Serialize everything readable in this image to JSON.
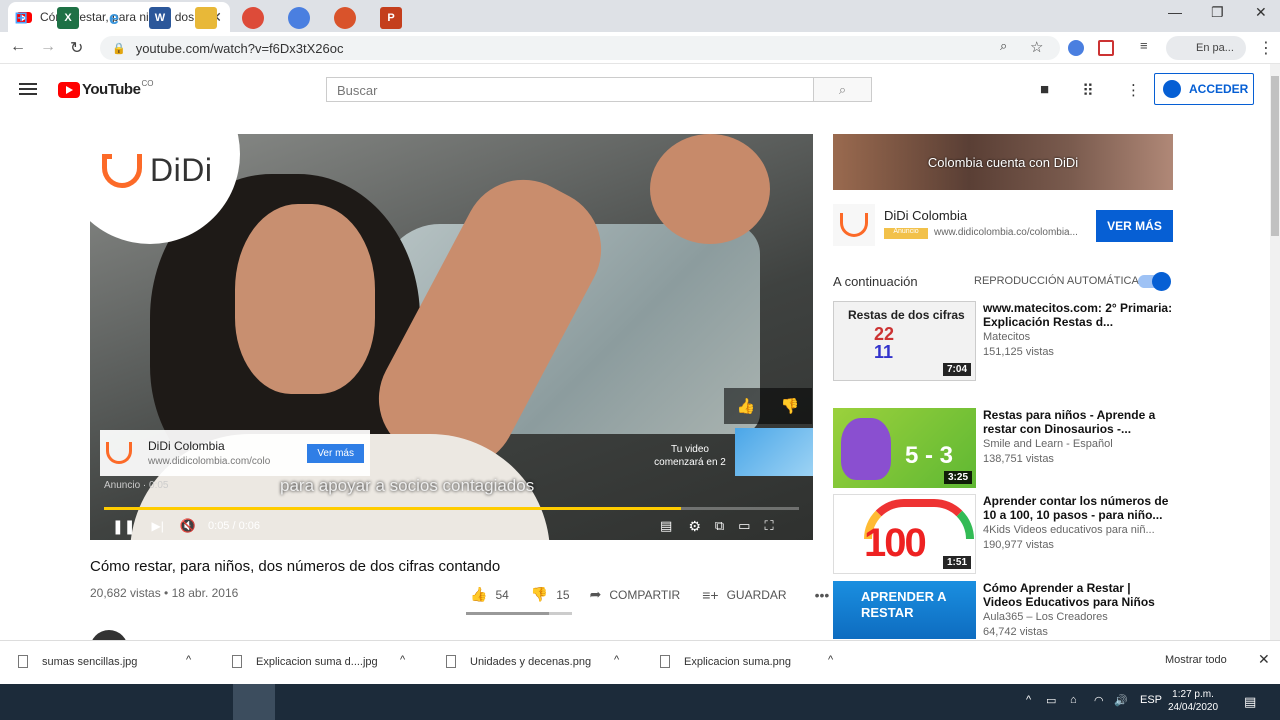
{
  "browser": {
    "tab_title": "Cómo restar, para niños, dos nú",
    "tab_close": "✕",
    "new_tab": "+",
    "url": "youtube.com/watch?v=f6Dx3tX26oc",
    "profile_label": "En pa...",
    "window_controls": [
      "—",
      "❐",
      "✕"
    ]
  },
  "youtube_header": {
    "logo_text": "YouTube",
    "country_code": "CO",
    "search_placeholder": "Buscar",
    "signin_label": "ACCEDER"
  },
  "player": {
    "brand": "DiDi",
    "ad_card_name": "DiDi Colombia",
    "ad_card_url": "www.didicolombia.com/colo",
    "ad_card_button": "Ver más",
    "caption": "para apoyar a socios contagiados",
    "up_next_countdown": "Tu video comenzará en 2",
    "ad_text": "Anuncio · 0:05",
    "time": "0:05 / 0:06",
    "progress_fraction": 0.83
  },
  "video": {
    "title": "Cómo restar, para niños, dos números de dos cifras contando",
    "meta": "20,682 vistas • 18 abr. 2016",
    "likes": "54",
    "dislikes": "15",
    "share_label": "COMPARTIR",
    "save_label": "GUARDAR",
    "like_ratio": 0.78
  },
  "sidebar": {
    "banner_text": "Colombia cuenta con DiDi",
    "promo_name": "DiDi Colombia",
    "promo_tag": "Anuncio",
    "promo_url": "www.didicolombia.co/colombia...",
    "promo_button": "VER MÁS",
    "next_label": "A continuación",
    "autoplay_label": "REPRODUCCIÓN AUTOMÁTICA",
    "recommendations": [
      {
        "title": "www.matecitos.com: 2° Primaria: Explicación Restas d...",
        "channel": "Matecitos",
        "views": "151,125 vistas",
        "duration": "7:04",
        "thumb_text": "Restas de dos cifras"
      },
      {
        "title": "Restas para niños - Aprende a restar con Dinosaurios -...",
        "channel": "Smile and Learn - Español",
        "views": "138,751 vistas",
        "duration": "3:25",
        "thumb_text": "5 - 3"
      },
      {
        "title": "Aprender contar los números de 10 a 100, 10 pasos - para niño...",
        "channel": "4Kids Videos educativos para niñ...",
        "views": "190,977 vistas",
        "duration": "1:51",
        "thumb_text": "100"
      },
      {
        "title": "Cómo Aprender a Restar | Videos Educativos para Niños",
        "channel": "Aula365 – Los Creadores",
        "views": "64,742 vistas",
        "duration": "",
        "thumb_text": "APRENDER A RESTAR"
      }
    ]
  },
  "downloads": {
    "items": [
      "sumas sencillas.jpg",
      "Explicacion suma d....jpg",
      "Unidades y decenas.png",
      "Explicacion suma.png"
    ],
    "show_all": "Mostrar todo"
  },
  "taskbar": {
    "language": "ESP",
    "time": "1:27 p.m.",
    "date": "24/04/2020"
  }
}
